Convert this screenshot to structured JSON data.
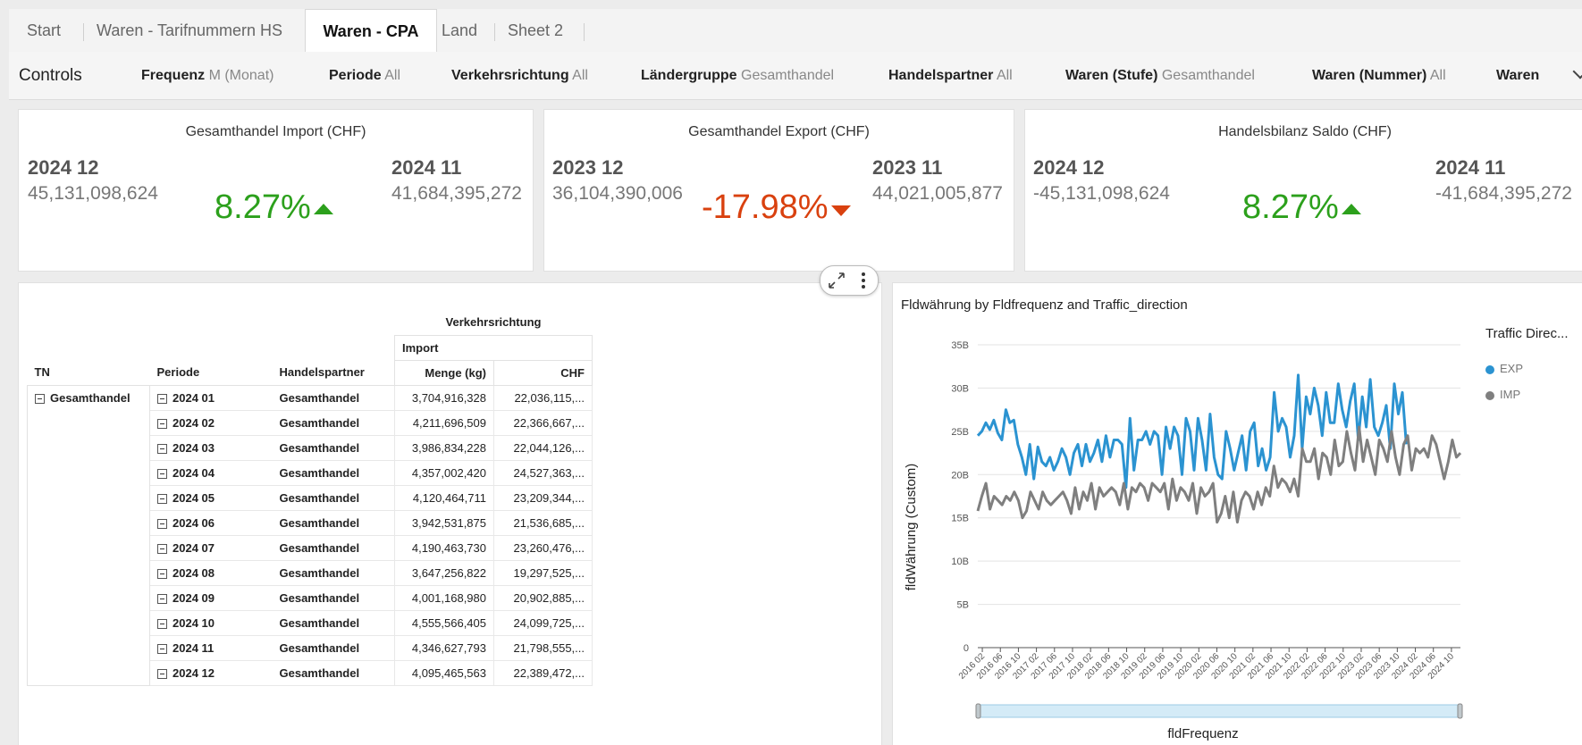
{
  "tabs": [
    {
      "label": "Start",
      "active": false
    },
    {
      "label": "Waren - Tarifnummern HS",
      "active": false
    },
    {
      "label": "Waren - CPA",
      "active": true
    },
    {
      "label": "Land",
      "active": false
    },
    {
      "label": "Sheet 2",
      "active": false
    }
  ],
  "controls": {
    "title": "Controls",
    "items": [
      {
        "key": "Frequenz",
        "value": "M (Monat)"
      },
      {
        "key": "Periode",
        "value": "All"
      },
      {
        "key": "Verkehrsrichtung",
        "value": "All"
      },
      {
        "key": "Ländergruppe",
        "value": "Gesamthandel"
      },
      {
        "key": "Handelspartner",
        "value": "All"
      },
      {
        "key": "Waren (Stufe)",
        "value": "Gesamthandel"
      },
      {
        "key": "Waren (Nummer)",
        "value": "All"
      },
      {
        "key": "Waren",
        "value": ""
      }
    ]
  },
  "kpis": [
    {
      "title": "Gesamthandel Import (CHF)",
      "period1": "2024 12",
      "value1": "45,131,098,624",
      "pct": "8.27%",
      "direction": "up",
      "period2": "2024 11",
      "value2": "41,684,395,272"
    },
    {
      "title": "Gesamthandel Export (CHF)",
      "period1": "2023 12",
      "value1": "36,104,390,006",
      "pct": "-17.98%",
      "direction": "down",
      "period2": "2023 11",
      "value2": "44,021,005,877"
    },
    {
      "title": "Handelsbilanz Saldo (CHF)",
      "period1": "2024 12",
      "value1": "-45,131,098,624",
      "pct": "8.27%",
      "direction": "up",
      "period2": "2024 11",
      "value2": "-41,684,395,272"
    }
  ],
  "pivot": {
    "group_header": "Verkehrsrichtung",
    "sub_header": "Import",
    "columns": [
      "TN",
      "Periode",
      "Handelspartner",
      "Menge (kg)",
      "CHF"
    ],
    "tn_value": "Gesamthandel",
    "rows": [
      {
        "periode": "2024 01",
        "partner": "Gesamthandel",
        "menge": "3,704,916,328",
        "chf": "22,036,115,..."
      },
      {
        "periode": "2024 02",
        "partner": "Gesamthandel",
        "menge": "4,211,696,509",
        "chf": "22,366,667,..."
      },
      {
        "periode": "2024 03",
        "partner": "Gesamthandel",
        "menge": "3,986,834,228",
        "chf": "22,044,126,..."
      },
      {
        "periode": "2024 04",
        "partner": "Gesamthandel",
        "menge": "4,357,002,420",
        "chf": "24,527,363,..."
      },
      {
        "periode": "2024 05",
        "partner": "Gesamthandel",
        "menge": "4,120,464,711",
        "chf": "23,209,344,..."
      },
      {
        "periode": "2024 06",
        "partner": "Gesamthandel",
        "menge": "3,942,531,875",
        "chf": "21,536,685,..."
      },
      {
        "periode": "2024 07",
        "partner": "Gesamthandel",
        "menge": "4,190,463,730",
        "chf": "23,260,476,..."
      },
      {
        "periode": "2024 08",
        "partner": "Gesamthandel",
        "menge": "3,647,256,822",
        "chf": "19,297,525,..."
      },
      {
        "periode": "2024 09",
        "partner": "Gesamthandel",
        "menge": "4,001,168,980",
        "chf": "20,902,885,..."
      },
      {
        "periode": "2024 10",
        "partner": "Gesamthandel",
        "menge": "4,555,566,405",
        "chf": "24,099,725,..."
      },
      {
        "periode": "2024 11",
        "partner": "Gesamthandel",
        "menge": "4,346,627,793",
        "chf": "21,798,555,..."
      },
      {
        "periode": "2024 12",
        "partner": "Gesamthandel",
        "menge": "4,095,465,563",
        "chf": "22,389,472,..."
      }
    ]
  },
  "colors": {
    "exp": "#2b93d1",
    "imp": "#7f7f7f",
    "up": "#2ca01c",
    "down": "#d9410f"
  },
  "chart_data": {
    "type": "line",
    "title": "Fldwährung by Fldfrequenz and Traffic_direction",
    "xlabel": "fldFrequenz",
    "ylabel": "fldWährung (Custom)",
    "legend_title": "Traffic Direc...",
    "legend_position": "right",
    "grid": true,
    "ylim": [
      0,
      35000000000
    ],
    "yticks": [
      0,
      5000000000,
      10000000000,
      15000000000,
      20000000000,
      25000000000,
      30000000000,
      35000000000
    ],
    "ytick_labels": [
      "0",
      "5B",
      "10B",
      "15B",
      "20B",
      "25B",
      "30B",
      "35B"
    ],
    "x_start": "2016 01",
    "x_end": "2024 12",
    "xtick_labels": [
      "2016 02",
      "2016 06",
      "2016 10",
      "2017 02",
      "2017 06",
      "2017 10",
      "2018 02",
      "2018 06",
      "2018 10",
      "2019 02",
      "2019 06",
      "2019 10",
      "2020 02",
      "2020 06",
      "2020 10",
      "2021 02",
      "2021 06",
      "2021 10",
      "2022 02",
      "2022 06",
      "2022 10",
      "2023 02",
      "2023 06",
      "2023 10",
      "2024 02",
      "2024 06",
      "2024 10"
    ],
    "series": [
      {
        "name": "EXP",
        "x_start": "2016 01",
        "x_end": "2023 12",
        "values": [
          24.5,
          25.0,
          26.0,
          25.2,
          26.3,
          24.8,
          24.0,
          27.5,
          26.0,
          26.3,
          23.5,
          22.0,
          20.0,
          23.5,
          19.5,
          23.2,
          21.5,
          21.0,
          22.0,
          20.5,
          21.5,
          23.0,
          22.0,
          20.0,
          22.5,
          23.5,
          21.0,
          23.5,
          21.5,
          22.5,
          24.0,
          21.5,
          24.5,
          22.0,
          24.0,
          24.0,
          23.5,
          18.5,
          26.5,
          20.5,
          24.0,
          24.0,
          25.0,
          23.5,
          25.0,
          24.5,
          20.0,
          25.5,
          23.0,
          25.5,
          24.5,
          20.0,
          26.5,
          25.0,
          20.5,
          26.5,
          24.0,
          20.5,
          27.0,
          22.0,
          20.0,
          19.5,
          25.0,
          23.0,
          20.5,
          22.5,
          24.5,
          20.5,
          25.0,
          26.0,
          21.0,
          23.0,
          20.5,
          22.0,
          29.5,
          25.0,
          26.5,
          25.5,
          22.0,
          24.5,
          31.5,
          23.0,
          29.0,
          27.0,
          30.0,
          28.0,
          24.5,
          29.5,
          26.0,
          26.0,
          30.5,
          27.5,
          25.5,
          28.5,
          30.5,
          24.0,
          29.0,
          25.5,
          31.0,
          25.5,
          24.5,
          26.0,
          28.0,
          23.0,
          30.5,
          27.0,
          29.5,
          23.5
        ]
      },
      {
        "name": "IMP",
        "x_start": "2016 01",
        "x_end": "2024 12",
        "values": [
          15.8,
          17.5,
          19.0,
          16.0,
          17.5,
          17.0,
          16.5,
          17.5,
          17.0,
          18.0,
          17.0,
          15.0,
          15.8,
          18.0,
          17.0,
          16.0,
          18.0,
          17.0,
          16.5,
          17.0,
          17.5,
          18.0,
          17.0,
          15.5,
          18.5,
          16.0,
          18.0,
          17.0,
          19.0,
          16.0,
          18.5,
          17.5,
          18.0,
          18.5,
          18.0,
          16.5,
          19.0,
          16.0,
          18.5,
          18.0,
          19.0,
          18.5,
          17.0,
          19.0,
          18.5,
          18.0,
          19.0,
          16.0,
          19.5,
          17.0,
          18.5,
          18.0,
          17.0,
          19.0,
          15.5,
          18.5,
          17.5,
          18.0,
          19.0,
          14.5,
          15.5,
          17.5,
          15.0,
          18.0,
          14.5,
          17.0,
          18.0,
          17.5,
          16.0,
          18.0,
          16.5,
          18.5,
          17.5,
          21.0,
          18.5,
          19.5,
          19.0,
          18.0,
          19.5,
          17.5,
          23.0,
          21.5,
          21.5,
          23.0,
          19.5,
          22.5,
          22.0,
          20.0,
          24.0,
          21.0,
          21.5,
          25.0,
          22.5,
          20.5,
          25.5,
          21.5,
          24.0,
          22.0,
          20.0,
          24.0,
          23.0,
          21.5,
          25.0,
          22.0,
          20.0,
          23.5,
          24.5,
          20.5,
          23.0,
          22.5,
          23.0,
          22.0,
          24.5,
          23.5,
          21.5,
          19.5,
          21.5,
          24.0,
          22.0,
          22.5
        ]
      }
    ],
    "value_unit_note": "values in billions (B) of CHF",
    "range_slider": true
  }
}
